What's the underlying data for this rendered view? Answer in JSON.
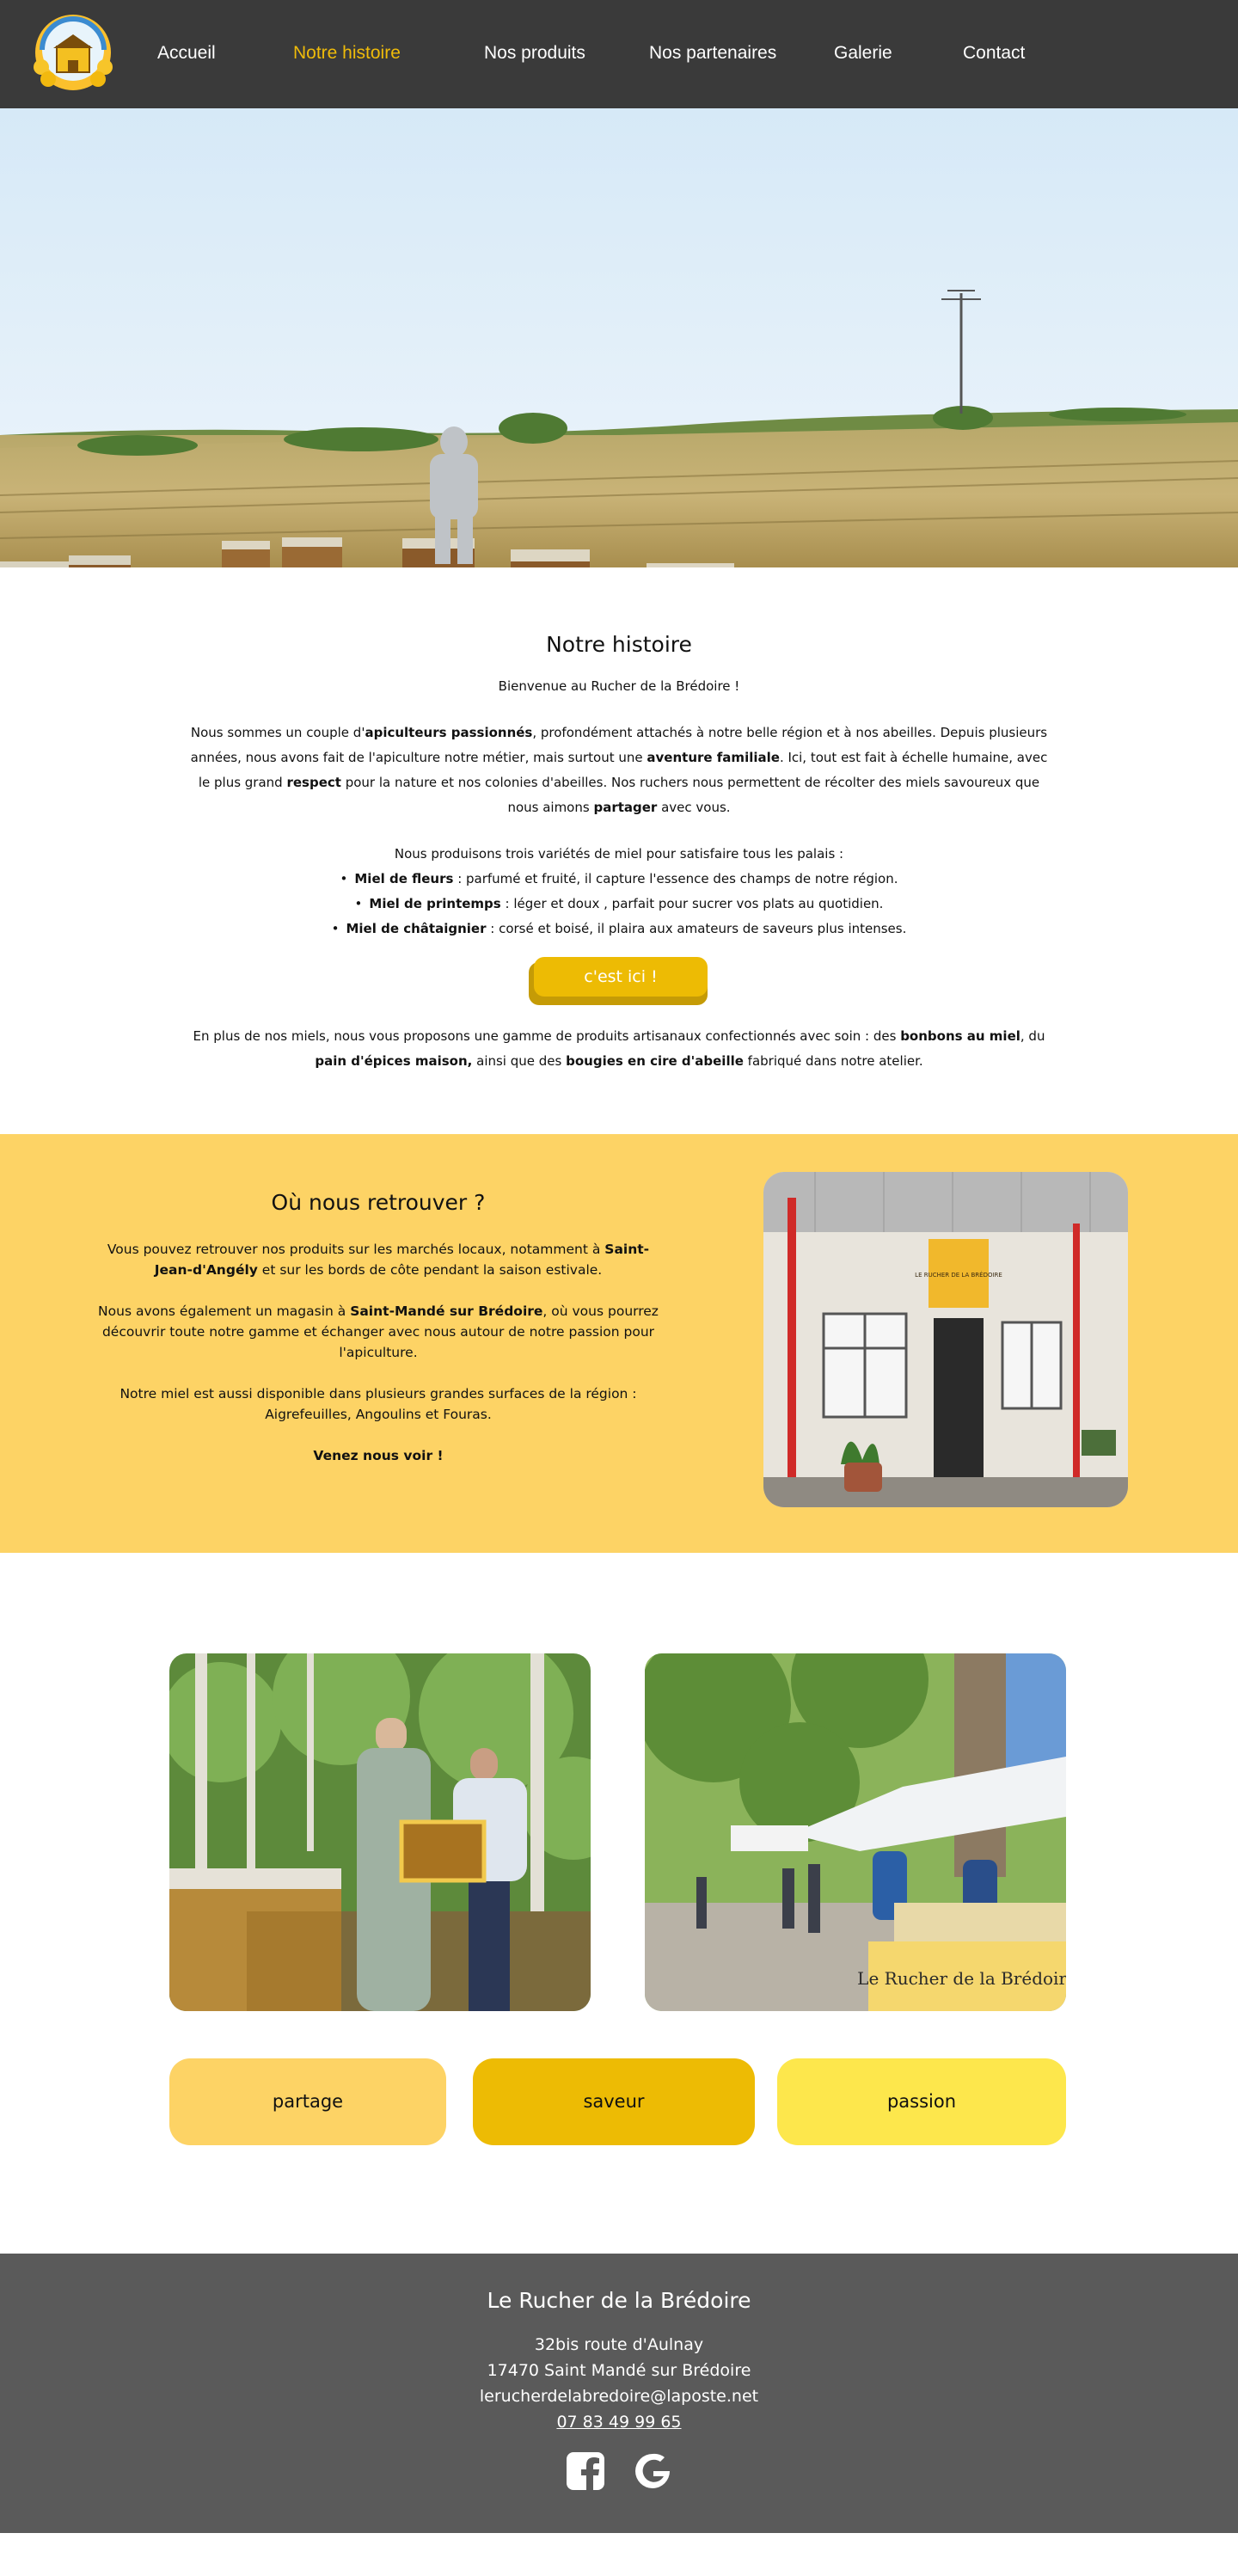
{
  "nav": {
    "logo_text": "Le Rucher de la Brédoire",
    "items": [
      {
        "label": "Accueil",
        "active": false
      },
      {
        "label": "Notre histoire",
        "active": true
      },
      {
        "label": "Nos produits",
        "active": false
      },
      {
        "label": "Nos partenaires",
        "active": false
      },
      {
        "label": "Galerie",
        "active": false
      },
      {
        "label": "Contact",
        "active": false
      }
    ]
  },
  "histoire": {
    "title": "Notre histoire",
    "intro": "Bienvenue au Rucher de la Brédoire !",
    "p1": {
      "a": "Nous sommes un couple d'",
      "b": "apiculteurs passionnés",
      "c": ", profondément attachés à notre belle région et à nos abeilles. Depuis plusieurs années, nous avons fait de l'apiculture notre métier, mais surtout une ",
      "d": "aventure familiale",
      "e": ". Ici, tout est fait à échelle humaine, avec le plus grand ",
      "f": "respect",
      "g": " pour la nature et nos colonies d'abeilles. Nos ruchers nous permettent de récolter des miels savoureux que nous aimons ",
      "h": "partager",
      "i": " avec vous."
    },
    "varieties_intro": "Nous produisons trois variétés de miel pour satisfaire tous les palais :",
    "varieties": [
      {
        "name": "Miel de fleurs",
        "desc": " : parfumé et fruité, il capture l'essence des champs de notre région."
      },
      {
        "name": "Miel de printemps",
        "desc": " : léger et doux , parfait pour sucrer vos plats au quotidien."
      },
      {
        "name": "Miel de châtaignier",
        "desc": " : corsé et boisé, il plaira aux amateurs de saveurs plus intenses."
      }
    ],
    "cta_label": "c'est ici !",
    "p2": {
      "a": "En plus de nos miels, nous vous proposons une gamme de produits artisanaux confectionnés avec soin : des ",
      "b": "bonbons au miel",
      "c": ", du ",
      "d": "pain d'épices maison,",
      "e": " ainsi que des ",
      "f": "bougies en cire d'abeille",
      "g": " fabriqué dans notre atelier."
    }
  },
  "retrouver": {
    "title": "Où nous retrouver ?",
    "p1a": "Vous pouvez retrouver nos produits sur les marchés locaux, notamment à ",
    "p1b": "Saint-Jean-d'Angély",
    "p1c": " et sur les bords de côte pendant la saison estivale.",
    "p2a": "Nous avons également  un magasin à ",
    "p2b": "Saint-Mandé sur Brédoire",
    "p2c": ", où vous pourrez découvrir toute notre gamme et échanger avec nous autour de notre passion pour l'apiculture.",
    "p3": "Notre miel est aussi disponible dans plusieurs grandes surfaces de la région : Aigrefeuilles, Angoulins et Fouras.",
    "p4": "Venez nous voir !",
    "shop_sign": "LE RUCHER DE LA BRÉDOIRE"
  },
  "market_banner": "Le Rucher de la Brédoire",
  "values": [
    {
      "label": "partage",
      "color": "#fdd365"
    },
    {
      "label": "saveur",
      "color": "#edbb04"
    },
    {
      "label": "passion",
      "color": "#fde74c"
    }
  ],
  "footer": {
    "title": "Le Rucher de la Brédoire",
    "address1": "32bis route d'Aulnay",
    "address2": "17470 Saint Mandé sur Brédoire",
    "email": "lerucherdelabredoire@laposte.net",
    "phone": "07 83 49 99 65",
    "socials": [
      "facebook-icon",
      "google-icon"
    ]
  },
  "colors": {
    "nav_bg": "#3a3a3a",
    "accent": "#efbb0a",
    "section_yellow": "#fdd365",
    "footer_bg": "#5a5a5a"
  }
}
